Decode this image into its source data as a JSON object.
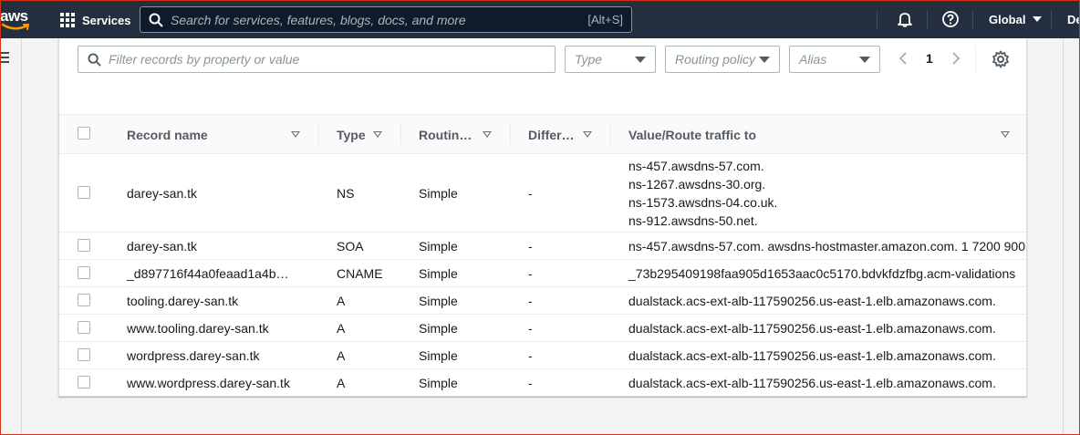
{
  "topnav": {
    "logo_text": "aws",
    "services_label": "Services",
    "search_placeholder": "Search for services, features, blogs, docs, and more",
    "search_shortcut": "[Alt+S]",
    "region_label": "Global",
    "account_label": "De"
  },
  "filters": {
    "filter_placeholder": "Filter records by property or value",
    "type_placeholder": "Type",
    "routing_placeholder": "Routing policy",
    "alias_placeholder": "Alias",
    "page_number": "1"
  },
  "table": {
    "columns": [
      "Record name",
      "Type",
      "Routin…",
      "Differ…",
      "Value/Route traffic to"
    ],
    "rows": [
      {
        "name": "darey-san.tk",
        "type": "NS",
        "routing": "Simple",
        "differ": "-",
        "values": [
          "ns-457.awsdns-57.com.",
          "ns-1267.awsdns-30.org.",
          "ns-1573.awsdns-04.co.uk.",
          "ns-912.awsdns-50.net."
        ]
      },
      {
        "name": "darey-san.tk",
        "type": "SOA",
        "routing": "Simple",
        "differ": "-",
        "values": [
          "ns-457.awsdns-57.com. awsdns-hostmaster.amazon.com. 1 7200 900"
        ]
      },
      {
        "name": "_d897716f44a0feaad1a4b…",
        "type": "CNAME",
        "routing": "Simple",
        "differ": "-",
        "values": [
          "_73b295409198faa905d1653aac0c5170.bdvkfdzfbg.acm-validations"
        ]
      },
      {
        "name": "tooling.darey-san.tk",
        "type": "A",
        "routing": "Simple",
        "differ": "-",
        "values": [
          "dualstack.acs-ext-alb-117590256.us-east-1.elb.amazonaws.com."
        ]
      },
      {
        "name": "www.tooling.darey-san.tk",
        "type": "A",
        "routing": "Simple",
        "differ": "-",
        "values": [
          "dualstack.acs-ext-alb-117590256.us-east-1.elb.amazonaws.com."
        ]
      },
      {
        "name": "wordpress.darey-san.tk",
        "type": "A",
        "routing": "Simple",
        "differ": "-",
        "values": [
          "dualstack.acs-ext-alb-117590256.us-east-1.elb.amazonaws.com."
        ]
      },
      {
        "name": "www.wordpress.darey-san.tk",
        "type": "A",
        "routing": "Simple",
        "differ": "-",
        "values": [
          "dualstack.acs-ext-alb-117590256.us-east-1.elb.amazonaws.com."
        ]
      }
    ]
  },
  "colors": {
    "nav_bg": "#232f3e",
    "accent_orange": "#ff9900",
    "frame_red": "#d13212"
  }
}
